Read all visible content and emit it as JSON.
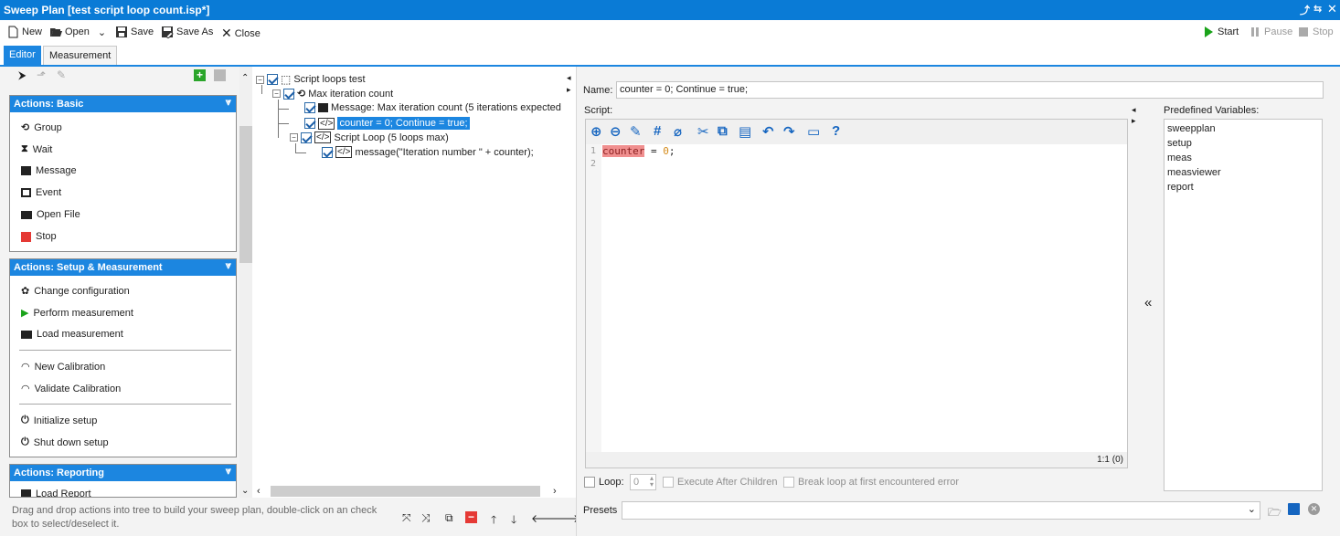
{
  "window": {
    "title": "Sweep Plan [test script loop count.isp*]"
  },
  "toolbar": {
    "new": "New",
    "open": "Open",
    "save": "Save",
    "save_as": "Save As",
    "close": "Close",
    "start": "Start",
    "pause": "Pause",
    "stop": "Stop"
  },
  "tabs": [
    {
      "label": "Editor"
    },
    {
      "label": "Measurement"
    }
  ],
  "sections": {
    "basic": {
      "title": "Actions: Basic",
      "items": [
        "Group",
        "Wait",
        "Message",
        "Event",
        "Open File",
        "Stop"
      ]
    },
    "setup": {
      "title": "Actions: Setup & Measurement",
      "items": [
        "Change configuration",
        "Perform measurement",
        "Load measurement",
        "New Calibration",
        "Validate Calibration",
        "Initialize setup",
        "Shut down setup"
      ]
    },
    "reporting": {
      "title": "Actions: Reporting",
      "items": [
        "Load Report"
      ]
    }
  },
  "tree": {
    "nodes": [
      "Script loops test",
      "Max iteration count",
      "Message: Max iteration count (5 iterations expected",
      "counter = 0; Continue = true;",
      "Script Loop (5 loops max)",
      "message(\"Iteration number \" + counter);"
    ]
  },
  "hint": "Drag and drop actions into tree to build your sweep plan, double-click on an check box to select/deselect it.",
  "props": {
    "name_label": "Name:",
    "name_value": "counter = 0; Continue = true;",
    "script_label": "Script:",
    "code_lines": [
      "1",
      "2"
    ],
    "code_tokens": {
      "ident": "counter",
      "op": " = ",
      "num": "0",
      "end": ";"
    },
    "status": "1:1 (0)",
    "predefined_label": "Predefined Variables:",
    "predefined": [
      "sweepplan",
      "setup",
      "meas",
      "measviewer",
      "report"
    ],
    "collapse_glyph": "«",
    "loop_label": "Loop:",
    "loop_value": "0",
    "exec_after": "Execute After Children",
    "break_loop": "Break loop at first encountered error",
    "presets_label": "Presets"
  },
  "colors": {
    "accent": "#1c86e0",
    "titlebar": "#0a7bd6",
    "start_green": "#1aa31a",
    "stop_red": "#e53935"
  }
}
